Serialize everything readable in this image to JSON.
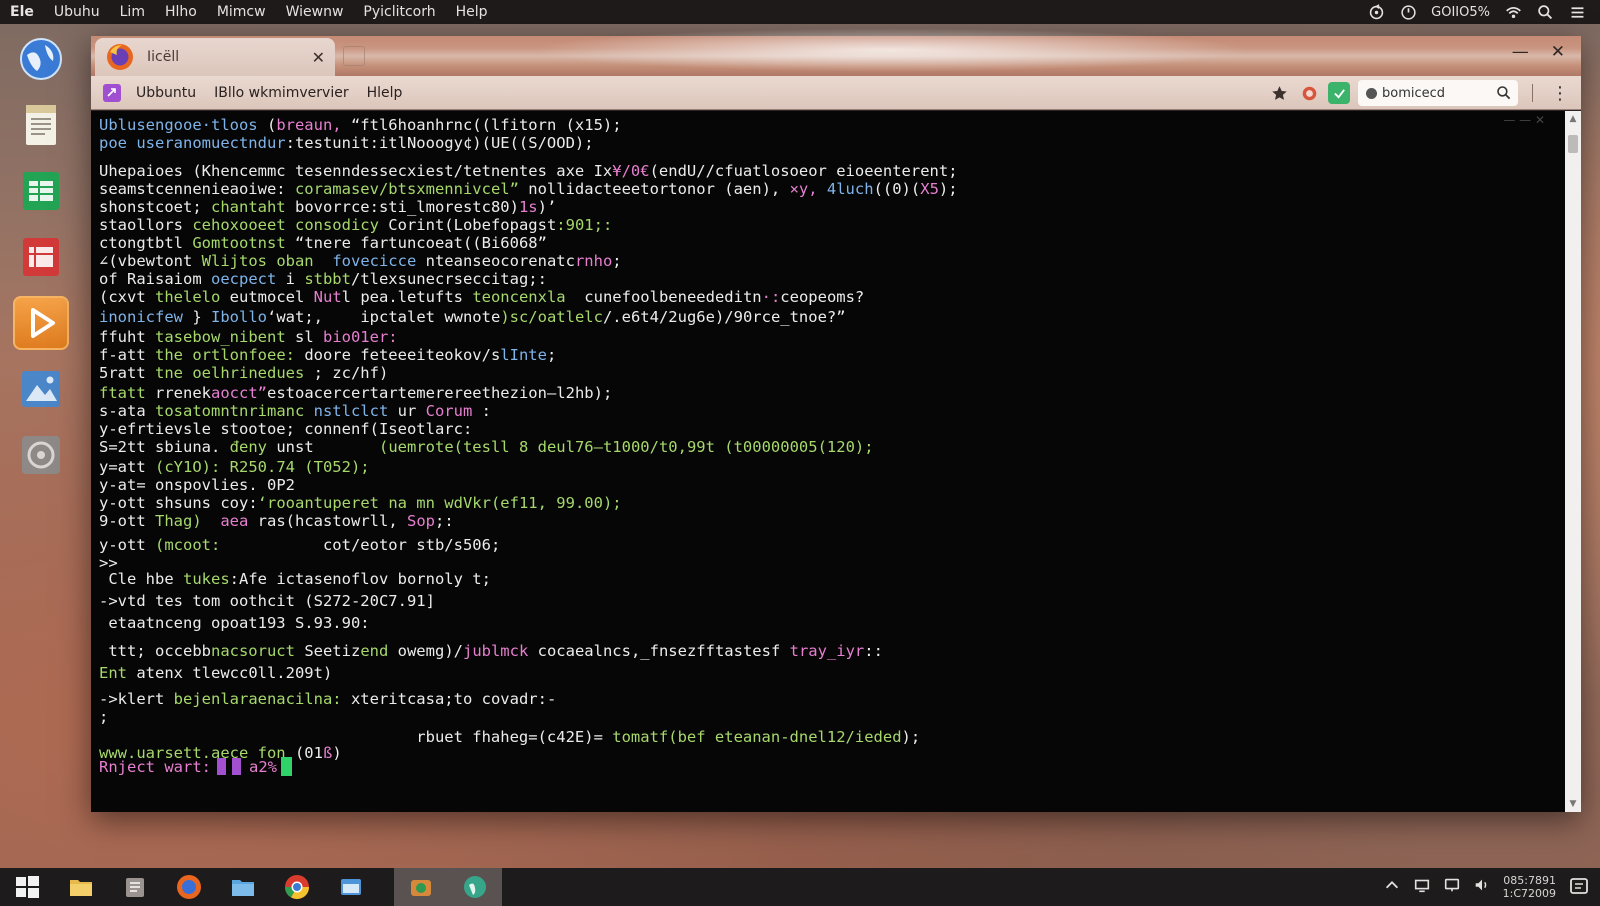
{
  "top_panel": {
    "menu": [
      "Ele",
      "Ubuhu",
      "Lim",
      "Hlho",
      "Mimcw",
      "Wiewnw",
      "Pyiclitcorh",
      "Help"
    ],
    "status_text": "GOIIO5%"
  },
  "browser": {
    "tab_title": "Iiсёll",
    "tab_close": "✕",
    "window_controls": {
      "minimize": "—",
      "close": "✕"
    },
    "toolbar_menu": [
      "Ubbuntu",
      "IBllo wkmimvervier",
      "Hlelp"
    ],
    "search": {
      "value": "bomicecd"
    },
    "menu_dots": "⋮"
  },
  "terminal": {
    "window_hint": "— — ✕",
    "lines": [
      [
        {
          "t": "Ublusengooe·tloos",
          "c": "blue"
        },
        {
          "t": " (",
          "c": "white"
        },
        {
          "t": "breaun,",
          "c": "pink"
        },
        {
          "t": " “ftl6hoanhrnc((lfitorn (x15);",
          "c": "white"
        }
      ],
      [
        {
          "t": "poe useranomuectndur",
          "c": "blue"
        },
        {
          "t": ":testunit:itlNooogy¢)(UE((S/OOD);",
          "c": "white"
        }
      ],
      [
        {
          "t": "Uhepaioes (Khencemmc tesenndessecxiest/tetnentes axe Ix",
          "c": "white"
        },
        {
          "t": "¥/0€",
          "c": "pink"
        },
        {
          "t": "(endU/∕cfuatlosoeor eioeenterent;",
          "c": "white"
        }
      ],
      [
        {
          "t": "seamstcennenieaoiwe:",
          "c": "white"
        },
        {
          "t": " coramasev/btsxmennivcel”",
          "c": "green"
        },
        {
          "t": " nollidacteeetortonor (aen), ",
          "c": "white"
        },
        {
          "t": "×y,",
          "c": "pink"
        },
        {
          "t": " 4luch",
          "c": "blue"
        },
        {
          "t": "((0)(",
          "c": "white"
        },
        {
          "t": "X5",
          "c": "pink"
        },
        {
          "t": ");",
          "c": "white"
        }
      ],
      [
        {
          "t": "shonstcoet;",
          "c": "white"
        },
        {
          "t": " chantaht",
          "c": "green"
        },
        {
          "t": " bovorrce:sti_lmorestc80)",
          "c": "white"
        },
        {
          "t": "1s",
          "c": "pink"
        },
        {
          "t": ")’",
          "c": "white"
        }
      ],
      [
        {
          "t": "staollors",
          "c": "white"
        },
        {
          "t": " cehoxooeet consodicy",
          "c": "green"
        },
        {
          "t": " Corint(Lobefopagst",
          "c": "white"
        },
        {
          "t": ":901;:",
          "c": "green"
        }
      ],
      [
        {
          "t": "ctongtbtl",
          "c": "white"
        },
        {
          "t": " Gomtootnst",
          "c": "green"
        },
        {
          "t": " “tnere fartuncoeat((Bi6068”",
          "c": "white"
        }
      ],
      [
        {
          "t": "∠(vbewtont",
          "c": "white"
        },
        {
          "t": " Wlijtos oban",
          "c": "green"
        },
        {
          "t": "  fovecicce",
          "c": "blue"
        },
        {
          "t": " nteanseocorenatc",
          "c": "white"
        },
        {
          "t": "rnho",
          "c": "pink"
        },
        {
          "t": ";",
          "c": "white"
        }
      ],
      [
        {
          "t": "of ",
          "c": "white"
        },
        {
          "t": "Raisaiom",
          "c": "white"
        },
        {
          "t": " oecpect",
          "c": "blue"
        },
        {
          "t": " i ",
          "c": "white"
        },
        {
          "t": "stbbt",
          "c": "green"
        },
        {
          "t": "/tlexsunecrseccitag;:",
          "c": "white"
        }
      ],
      [
        {
          "t": "(cxvt",
          "c": "white"
        },
        {
          "t": " thelelo",
          "c": "green"
        },
        {
          "t": " eutmocel ",
          "c": "white"
        },
        {
          "t": "Nut",
          "c": "pink"
        },
        {
          "t": "l",
          "c": "white"
        },
        {
          "t": " pea.letufts",
          "c": "white"
        },
        {
          "t": " teoncenxla",
          "c": "green"
        },
        {
          "t": "  cunefoolbeneededitn",
          "c": "white"
        },
        {
          "t": "·:",
          "c": "pink"
        },
        {
          "t": "ceopeoms?",
          "c": "white"
        }
      ],
      [
        {
          "t": "inonicfew",
          "c": "blue"
        },
        {
          "t": " } ",
          "c": "white"
        },
        {
          "t": "Ibollo",
          "c": "blue"
        },
        {
          "t": "‘wat;,",
          "c": "white"
        },
        {
          "t": "    ipctalet",
          "c": "white"
        },
        {
          "t": " wwnote",
          "c": "white"
        },
        {
          "t": ")sc/oatlelc",
          "c": "green"
        },
        {
          "t": "/.e6t4/2ug6e)/90rce_tnoe?”",
          "c": "white"
        }
      ],
      [
        {
          "t": "ffuht",
          "c": "white"
        },
        {
          "t": " tasebow_nibent",
          "c": "green"
        },
        {
          "t": " sl ",
          "c": "white"
        },
        {
          "t": "bio01er:",
          "c": "pink"
        }
      ],
      [
        {
          "t": "f-att",
          "c": "white"
        },
        {
          "t": " the ortlonfoee:",
          "c": "green"
        },
        {
          "t": " doore feteeeiteokov/s",
          "c": "white"
        },
        {
          "t": "lInte",
          "c": "blue"
        },
        {
          "t": ";",
          "c": "white"
        }
      ],
      [
        {
          "t": "5ratt",
          "c": "white"
        },
        {
          "t": " tne oelhrinedues",
          "c": "green"
        },
        {
          "t": " ; zc/hf)",
          "c": "white"
        }
      ],
      [
        {
          "t": "ftatt",
          "c": "green"
        },
        {
          "t": " rrenek",
          "c": "white"
        },
        {
          "t": "aocct”",
          "c": "pink"
        },
        {
          "t": "estoacercertartemerereethezion–l2hb);",
          "c": "white"
        }
      ],
      [
        {
          "t": "s-ata",
          "c": "white"
        },
        {
          "t": " tosatomntnrimanc",
          "c": "green"
        },
        {
          "t": " nstlclct",
          "c": "blue"
        },
        {
          "t": " ur",
          "c": "white"
        },
        {
          "t": " Corum",
          "c": "pink"
        },
        {
          "t": " :",
          "c": "white"
        }
      ],
      [
        {
          "t": "y-efrtievsle stootoe;",
          "c": "white"
        },
        {
          "t": " connenf(Iseotlarc:",
          "c": "white"
        }
      ],
      [
        {
          "t": "S=2tt",
          "c": "white"
        },
        {
          "t": " sbiuna.",
          "c": "white"
        },
        {
          "t": " đeny",
          "c": "green"
        },
        {
          "t": " unst",
          "c": "white"
        },
        {
          "t": "       (uemrote(tesll 8 deul76–t1000/t0,99t (t00000005(120);",
          "c": "green"
        }
      ],
      [
        {
          "t": "y=att",
          "c": "white"
        },
        {
          "t": " (cY1O): R250.74 (T052);",
          "c": "green"
        }
      ],
      [
        {
          "t": "y-at=",
          "c": "white"
        },
        {
          "t": " onspovlies. 0P2",
          "c": "white"
        }
      ],
      [
        {
          "t": "y-ott",
          "c": "white"
        },
        {
          "t": " shsuns",
          "c": "white"
        },
        {
          "t": " coy:",
          "c": "white"
        },
        {
          "t": "‘rooantuperet na mn wdVkr(ef11, 99.00);",
          "c": "green"
        }
      ],
      [
        {
          "t": "9-ott",
          "c": "white"
        },
        {
          "t": " Thag)",
          "c": "green"
        },
        {
          "t": "  ",
          "c": "white"
        },
        {
          "t": "aea",
          "c": "pink"
        },
        {
          "t": " ras(hcastowrll,",
          "c": "white"
        },
        {
          "t": " Sop",
          "c": "pink"
        },
        {
          "t": ";:",
          "c": "white"
        }
      ],
      [
        {
          "t": "y-ott",
          "c": "white"
        },
        {
          "t": " (mcoot:",
          "c": "green"
        },
        {
          "t": "           cot/eotor stb/s506;",
          "c": "white"
        }
      ],
      [
        {
          "t": ">>",
          "c": "white"
        }
      ],
      [
        {
          "t": " Cle hbe",
          "c": "white"
        },
        {
          "t": " tukes",
          "c": "green"
        },
        {
          "t": ":Afe ictasenoflov bornoly t;",
          "c": "white"
        }
      ],
      [
        {
          "t": "->vtd tes tom oothcit (S272-20C7.91]",
          "c": "white"
        }
      ],
      [
        {
          "t": " etaatnceng opoat193 S.93.90:",
          "c": "white"
        }
      ],
      [
        {
          "t": " ttt; occebb",
          "c": "white"
        },
        {
          "t": "nacsoruct",
          "c": "green"
        },
        {
          "t": " Seetiz",
          "c": "white"
        },
        {
          "t": "end",
          "c": "green"
        },
        {
          "t": " owemg",
          "c": "white"
        },
        {
          "t": ")/",
          "c": "white"
        },
        {
          "t": "jublmck",
          "c": "pink"
        },
        {
          "t": " cocaealncs,_fnsezfftastesf ",
          "c": "white"
        },
        {
          "t": "tray_iyr",
          "c": "pink"
        },
        {
          "t": "::",
          "c": "white"
        }
      ],
      [
        {
          "t": "Ent",
          "c": "green"
        },
        {
          "t": " atenx tlewcc0ll.209t)",
          "c": "white"
        }
      ],
      [
        {
          "t": "->klert",
          "c": "white"
        },
        {
          "t": " bejenlaraenacilna:",
          "c": "green"
        },
        {
          "t": " xteritcasa;to covadr:-",
          "c": "white"
        }
      ],
      [
        {
          "t": ";",
          "c": "white"
        }
      ],
      [
        {
          "t": "                                  rbuet fhaheg=(c42E)=",
          "c": "white"
        },
        {
          "t": " tomatf(bef eteanan-dnel12/ieded",
          "c": "green"
        },
        {
          "t": ");",
          "c": "white"
        }
      ],
      [
        {
          "t": "www.uarsett.aece",
          "c": "green"
        },
        {
          "t": " fon",
          "c": "green"
        },
        {
          "t": " (01",
          "c": "white"
        },
        {
          "t": "ß",
          "c": "pink"
        },
        {
          "t": ")",
          "c": "white"
        }
      ]
    ],
    "prompt_label": "Rnject wart:",
    "prompt_percent": "a2%"
  },
  "taskbar": {
    "clock_time": "085:7891",
    "clock_date": "1:C72009"
  }
}
